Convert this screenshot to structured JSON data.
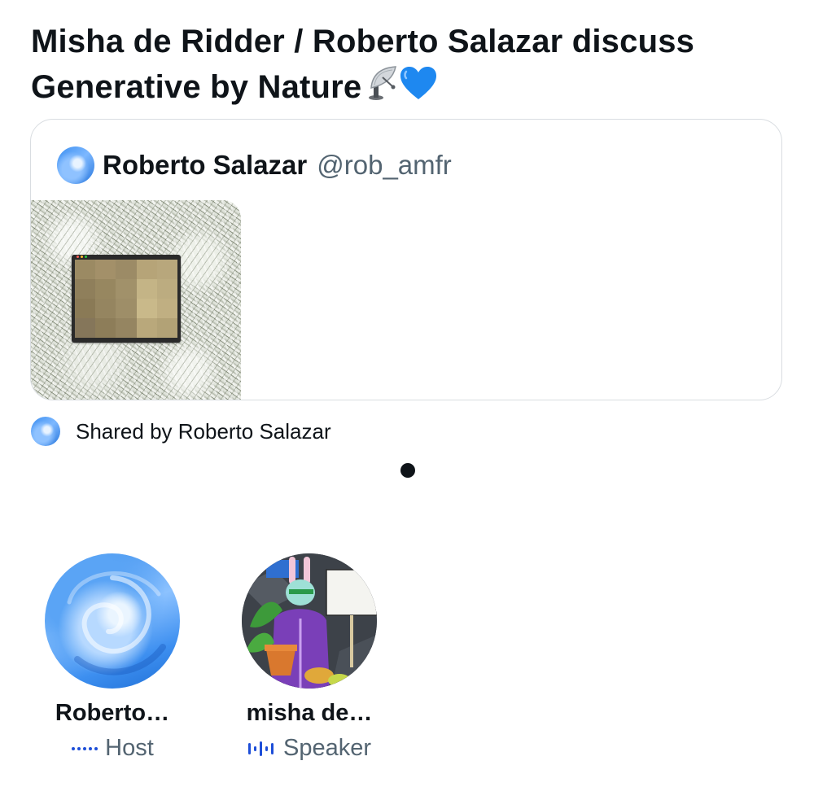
{
  "space": {
    "title": "Misha de Ridder / Roberto Salazar discuss Generative by Nature",
    "title_emoji": "📡💙"
  },
  "card": {
    "author_name": "Roberto Salazar",
    "author_handle": "@rob_amfr"
  },
  "shared": {
    "text": "Shared by Roberto Salazar"
  },
  "participants": [
    {
      "name": "Roberto…",
      "role": "Host",
      "role_icon": "host-dots-icon"
    },
    {
      "name": "misha de…",
      "role": "Speaker",
      "role_icon": "speaker-bars-icon"
    }
  ],
  "colors": {
    "accent": "#1d4ed8",
    "text": "#0f1419",
    "secondary_text": "#536471",
    "border": "#d9dde1"
  }
}
